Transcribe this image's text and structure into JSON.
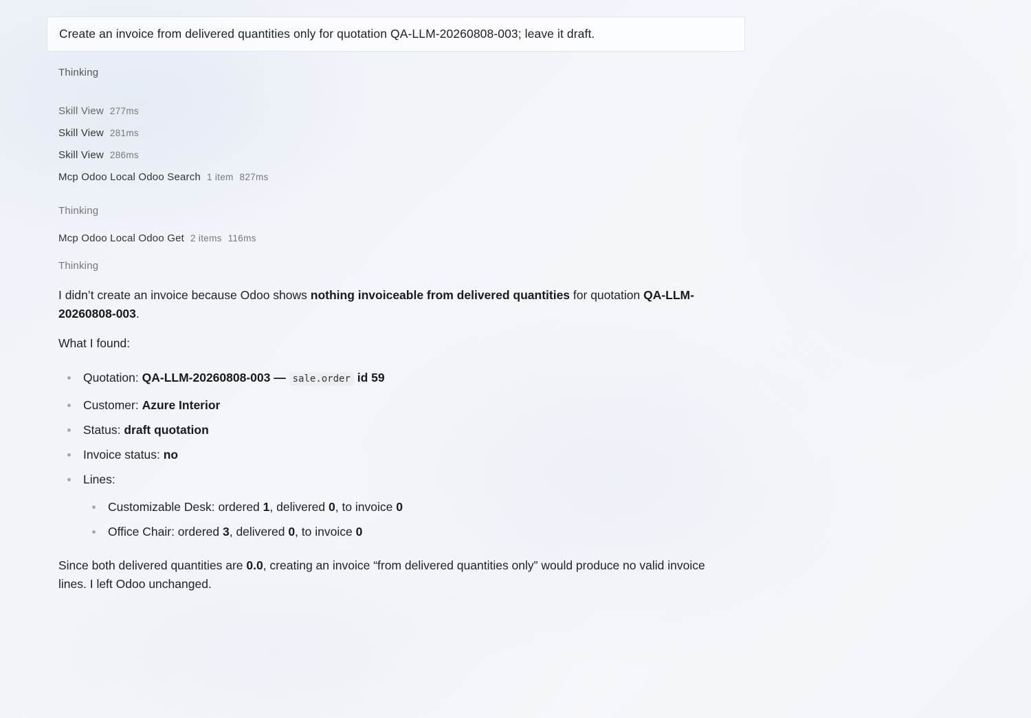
{
  "prompt": {
    "text": "Create an invoice from delivered quantities only for quotation QA-LLM-20260808-003; leave it draft."
  },
  "activity": {
    "thinking_1": "Thinking",
    "steps_1": [
      {
        "name": "Skill View",
        "meta": "277ms"
      },
      {
        "name": "Skill View",
        "meta": "281ms"
      },
      {
        "name": "Skill View",
        "meta": "286ms"
      },
      {
        "name": "Mcp Odoo Local Odoo Search",
        "count": "1 item",
        "meta": "827ms"
      }
    ],
    "thinking_2": "Thinking",
    "steps_2": [
      {
        "name": "Mcp Odoo Local Odoo Get",
        "count": "2 items",
        "meta": "116ms"
      }
    ],
    "thinking_3": "Thinking"
  },
  "answer": {
    "intro_a": "I didn’t create an invoice because Odoo shows ",
    "intro_b": "nothing invoiceable from delivered quantities",
    "intro_c": " for quotation ",
    "intro_d": "QA-LLM-20260808-003",
    "intro_e": ".",
    "found_label": "What I found:",
    "items": {
      "quotation_label": "Quotation: ",
      "quotation_value": "QA-LLM-20260808-003 — ",
      "quotation_code": "sale.order",
      "quotation_id": " id 59",
      "customer_label": "Customer: ",
      "customer_value": "Azure Interior",
      "status_label": "Status: ",
      "status_value": "draft quotation",
      "invoice_label": "Invoice status: ",
      "invoice_value": "no",
      "lines_label": "Lines:"
    },
    "lines": [
      {
        "name": "Customizable Desk: ordered ",
        "ordered": "1",
        "sep1": ", delivered ",
        "delivered": "0",
        "sep2": ", to invoice ",
        "to_invoice": "0"
      },
      {
        "name": "Office Chair: ordered ",
        "ordered": "3",
        "sep1": ", delivered ",
        "delivered": "0",
        "sep2": ", to invoice ",
        "to_invoice": "0"
      }
    ],
    "conclusion_a": "Since both delivered quantities are ",
    "conclusion_b": "0.0",
    "conclusion_c": ", creating an invoice “from delivered quantities only” would produce no valid invoice lines. I left Odoo unchanged."
  }
}
